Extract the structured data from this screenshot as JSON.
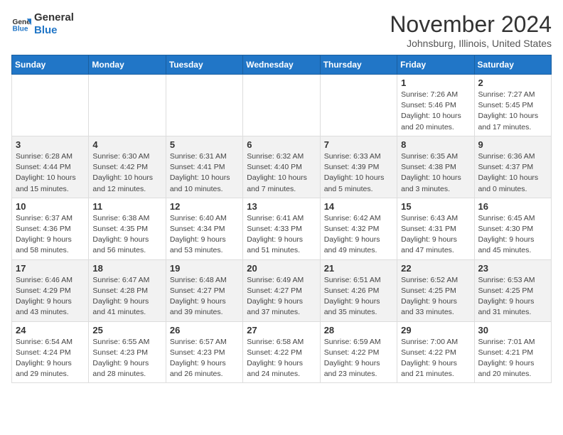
{
  "header": {
    "logo_line1": "General",
    "logo_line2": "Blue",
    "month_title": "November 2024",
    "location": "Johnsburg, Illinois, United States"
  },
  "weekdays": [
    "Sunday",
    "Monday",
    "Tuesday",
    "Wednesday",
    "Thursday",
    "Friday",
    "Saturday"
  ],
  "weeks": [
    [
      {
        "day": "",
        "detail": ""
      },
      {
        "day": "",
        "detail": ""
      },
      {
        "day": "",
        "detail": ""
      },
      {
        "day": "",
        "detail": ""
      },
      {
        "day": "",
        "detail": ""
      },
      {
        "day": "1",
        "detail": "Sunrise: 7:26 AM\nSunset: 5:46 PM\nDaylight: 10 hours\nand 20 minutes."
      },
      {
        "day": "2",
        "detail": "Sunrise: 7:27 AM\nSunset: 5:45 PM\nDaylight: 10 hours\nand 17 minutes."
      }
    ],
    [
      {
        "day": "3",
        "detail": "Sunrise: 6:28 AM\nSunset: 4:44 PM\nDaylight: 10 hours\nand 15 minutes."
      },
      {
        "day": "4",
        "detail": "Sunrise: 6:30 AM\nSunset: 4:42 PM\nDaylight: 10 hours\nand 12 minutes."
      },
      {
        "day": "5",
        "detail": "Sunrise: 6:31 AM\nSunset: 4:41 PM\nDaylight: 10 hours\nand 10 minutes."
      },
      {
        "day": "6",
        "detail": "Sunrise: 6:32 AM\nSunset: 4:40 PM\nDaylight: 10 hours\nand 7 minutes."
      },
      {
        "day": "7",
        "detail": "Sunrise: 6:33 AM\nSunset: 4:39 PM\nDaylight: 10 hours\nand 5 minutes."
      },
      {
        "day": "8",
        "detail": "Sunrise: 6:35 AM\nSunset: 4:38 PM\nDaylight: 10 hours\nand 3 minutes."
      },
      {
        "day": "9",
        "detail": "Sunrise: 6:36 AM\nSunset: 4:37 PM\nDaylight: 10 hours\nand 0 minutes."
      }
    ],
    [
      {
        "day": "10",
        "detail": "Sunrise: 6:37 AM\nSunset: 4:36 PM\nDaylight: 9 hours\nand 58 minutes."
      },
      {
        "day": "11",
        "detail": "Sunrise: 6:38 AM\nSunset: 4:35 PM\nDaylight: 9 hours\nand 56 minutes."
      },
      {
        "day": "12",
        "detail": "Sunrise: 6:40 AM\nSunset: 4:34 PM\nDaylight: 9 hours\nand 53 minutes."
      },
      {
        "day": "13",
        "detail": "Sunrise: 6:41 AM\nSunset: 4:33 PM\nDaylight: 9 hours\nand 51 minutes."
      },
      {
        "day": "14",
        "detail": "Sunrise: 6:42 AM\nSunset: 4:32 PM\nDaylight: 9 hours\nand 49 minutes."
      },
      {
        "day": "15",
        "detail": "Sunrise: 6:43 AM\nSunset: 4:31 PM\nDaylight: 9 hours\nand 47 minutes."
      },
      {
        "day": "16",
        "detail": "Sunrise: 6:45 AM\nSunset: 4:30 PM\nDaylight: 9 hours\nand 45 minutes."
      }
    ],
    [
      {
        "day": "17",
        "detail": "Sunrise: 6:46 AM\nSunset: 4:29 PM\nDaylight: 9 hours\nand 43 minutes."
      },
      {
        "day": "18",
        "detail": "Sunrise: 6:47 AM\nSunset: 4:28 PM\nDaylight: 9 hours\nand 41 minutes."
      },
      {
        "day": "19",
        "detail": "Sunrise: 6:48 AM\nSunset: 4:27 PM\nDaylight: 9 hours\nand 39 minutes."
      },
      {
        "day": "20",
        "detail": "Sunrise: 6:49 AM\nSunset: 4:27 PM\nDaylight: 9 hours\nand 37 minutes."
      },
      {
        "day": "21",
        "detail": "Sunrise: 6:51 AM\nSunset: 4:26 PM\nDaylight: 9 hours\nand 35 minutes."
      },
      {
        "day": "22",
        "detail": "Sunrise: 6:52 AM\nSunset: 4:25 PM\nDaylight: 9 hours\nand 33 minutes."
      },
      {
        "day": "23",
        "detail": "Sunrise: 6:53 AM\nSunset: 4:25 PM\nDaylight: 9 hours\nand 31 minutes."
      }
    ],
    [
      {
        "day": "24",
        "detail": "Sunrise: 6:54 AM\nSunset: 4:24 PM\nDaylight: 9 hours\nand 29 minutes."
      },
      {
        "day": "25",
        "detail": "Sunrise: 6:55 AM\nSunset: 4:23 PM\nDaylight: 9 hours\nand 28 minutes."
      },
      {
        "day": "26",
        "detail": "Sunrise: 6:57 AM\nSunset: 4:23 PM\nDaylight: 9 hours\nand 26 minutes."
      },
      {
        "day": "27",
        "detail": "Sunrise: 6:58 AM\nSunset: 4:22 PM\nDaylight: 9 hours\nand 24 minutes."
      },
      {
        "day": "28",
        "detail": "Sunrise: 6:59 AM\nSunset: 4:22 PM\nDaylight: 9 hours\nand 23 minutes."
      },
      {
        "day": "29",
        "detail": "Sunrise: 7:00 AM\nSunset: 4:22 PM\nDaylight: 9 hours\nand 21 minutes."
      },
      {
        "day": "30",
        "detail": "Sunrise: 7:01 AM\nSunset: 4:21 PM\nDaylight: 9 hours\nand 20 minutes."
      }
    ]
  ]
}
